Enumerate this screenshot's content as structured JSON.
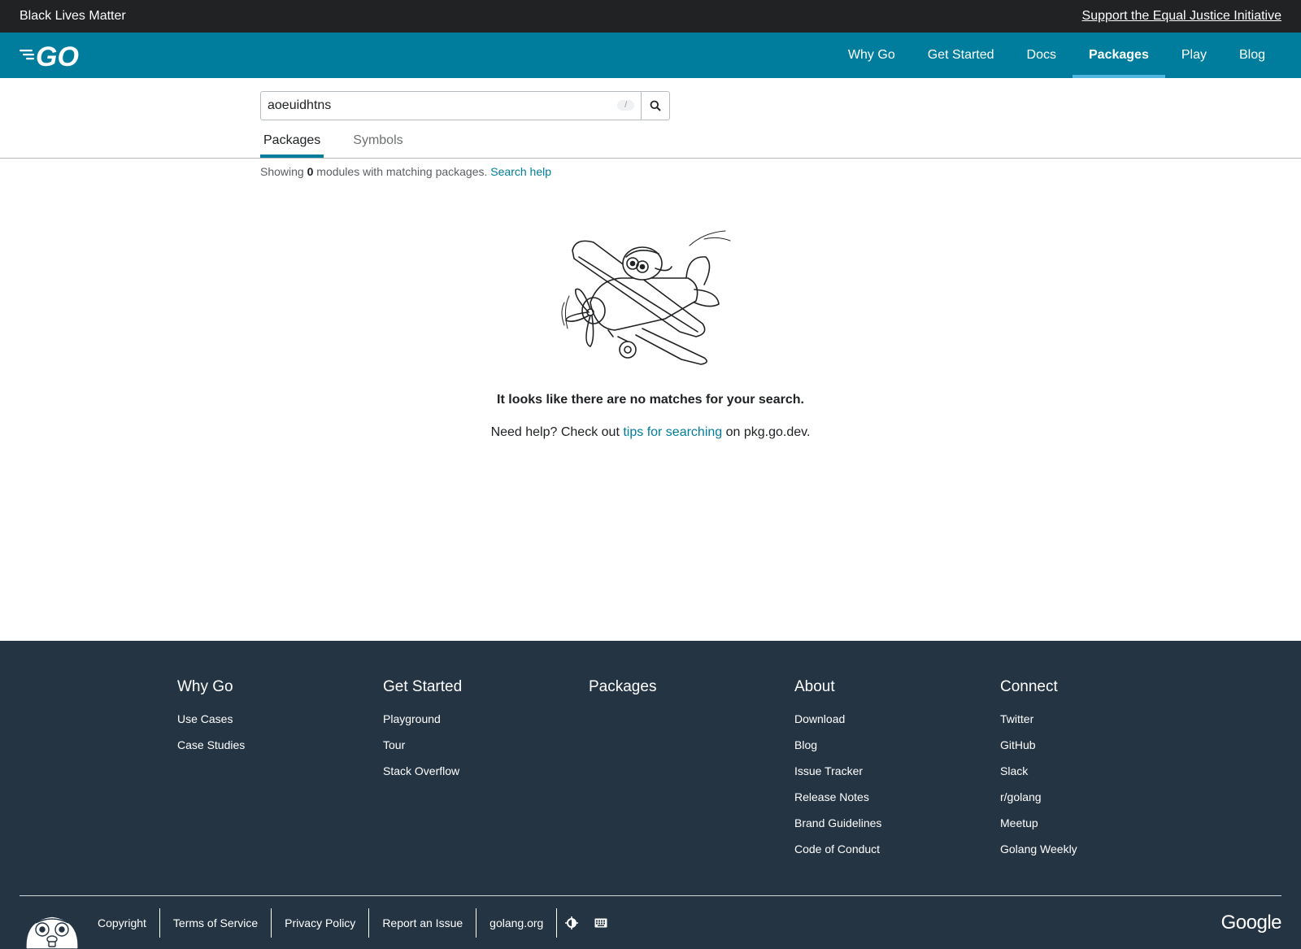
{
  "banner": {
    "left_text": "Black Lives Matter",
    "right_link": "Support the Equal Justice Initiative"
  },
  "header": {
    "logo_alt": "GO",
    "nav": [
      "Why Go",
      "Get Started",
      "Docs",
      "Packages",
      "Play",
      "Blog"
    ],
    "active_nav": "Packages"
  },
  "search": {
    "value": "aoeuidhtns",
    "shortcut": "/"
  },
  "tabs": [
    "Packages",
    "Symbols"
  ],
  "active_tab": "Packages",
  "results": {
    "prefix": "Showing",
    "count": "0",
    "suffix": "modules with matching packages.",
    "help_link": "Search help"
  },
  "empty": {
    "title": "It looks like there are no matches for your search.",
    "help_prefix": "Need help? Check out",
    "help_link": "tips for searching",
    "help_suffix": "on pkg.go.dev."
  },
  "footer": {
    "columns": [
      {
        "title": "Why Go",
        "links": [
          "Use Cases",
          "Case Studies"
        ]
      },
      {
        "title": "Get Started",
        "links": [
          "Playground",
          "Tour",
          "Stack Overflow"
        ]
      },
      {
        "title": "Packages",
        "links": []
      },
      {
        "title": "About",
        "links": [
          "Download",
          "Blog",
          "Issue Tracker",
          "Release Notes",
          "Brand Guidelines",
          "Code of Conduct"
        ]
      },
      {
        "title": "Connect",
        "links": [
          "Twitter",
          "GitHub",
          "Slack",
          "r/golang",
          "Meetup",
          "Golang Weekly"
        ]
      }
    ],
    "bottom_links": [
      "Copyright",
      "Terms of Service",
      "Privacy Policy",
      "Report an Issue",
      "golang.org"
    ],
    "icons": [
      "theme-toggle-icon",
      "keyboard-icon"
    ],
    "brand": "Google"
  },
  "colors": {
    "banner_bg": "#202224",
    "header_bg": "#007d9c",
    "active_underline": "#50b7e0",
    "link": "#007d9c",
    "footer_bg": "#253443"
  }
}
